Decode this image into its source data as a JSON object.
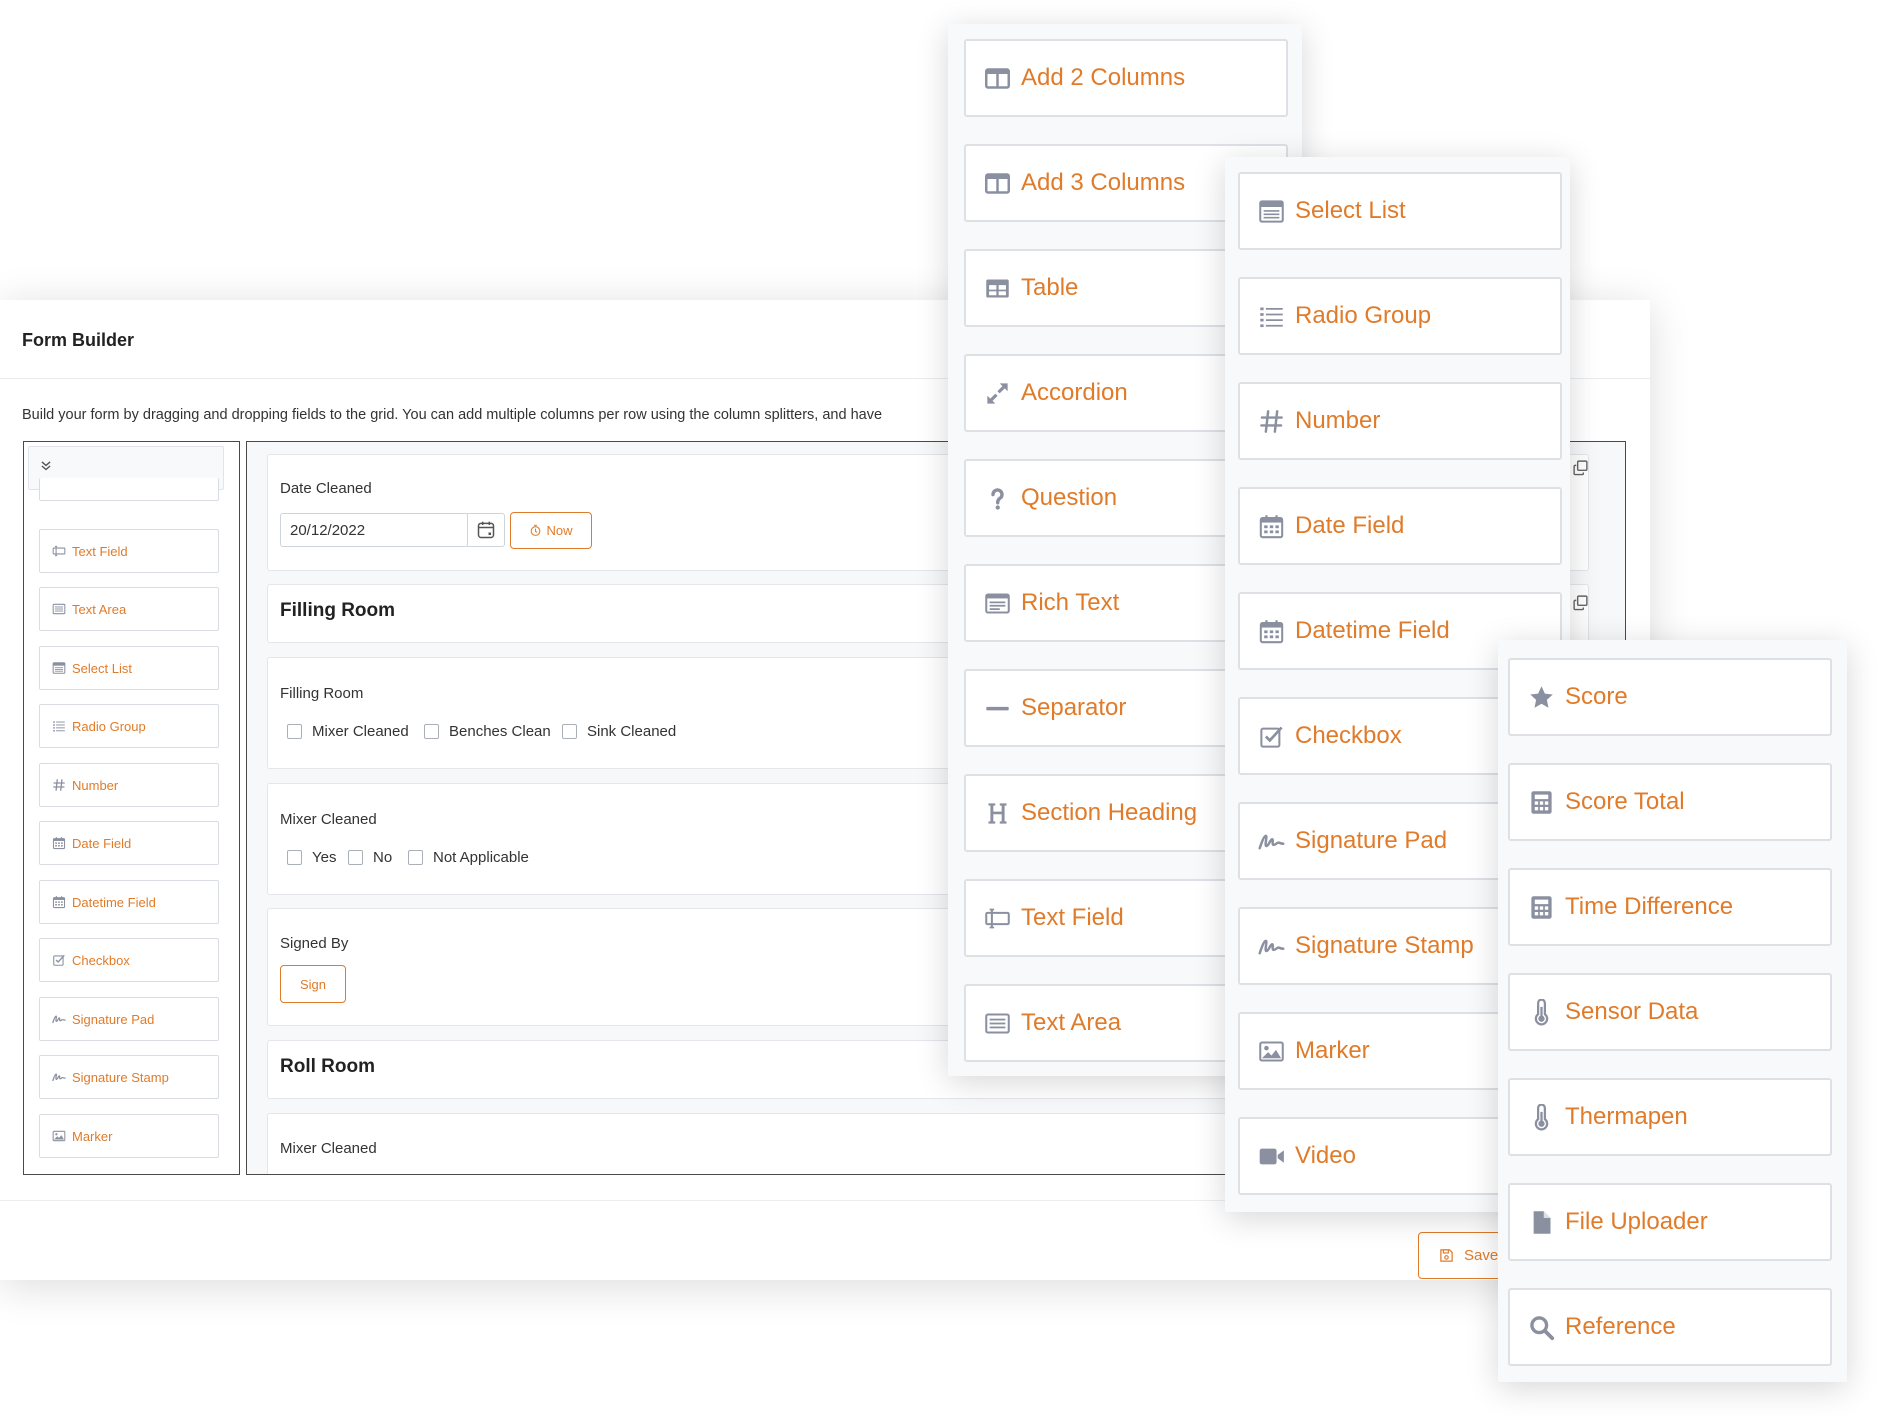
{
  "form_builder": {
    "title": "Form Builder",
    "description": "Build your form by dragging and dropping fields to the grid. You can add multiple columns per row using the column splitters, and have",
    "sidebar": {
      "items": [
        "Text Field",
        "Text Area",
        "Select List",
        "Radio Group",
        "Number",
        "Date Field",
        "Datetime Field",
        "Checkbox",
        "Signature Pad",
        "Signature Stamp",
        "Marker"
      ]
    },
    "grid": {
      "date_cleaned": {
        "label": "Date Cleaned",
        "value": "20/12/2022",
        "now_label": "Now"
      },
      "section_filling_room": "Filling Room",
      "filling_room_field": {
        "label": "Filling Room",
        "options": [
          "Mixer Cleaned",
          "Benches Clean",
          "Sink Cleaned"
        ]
      },
      "mixer_cleaned_field": {
        "label": "Mixer Cleaned",
        "options": [
          "Yes",
          "No",
          "Not Applicable"
        ]
      },
      "signed_by": {
        "label": "Signed By",
        "sign_label": "Sign"
      },
      "section_roll_room": "Roll Room",
      "mixer_cleaned_2": {
        "label": "Mixer Cleaned"
      }
    },
    "save_label": "Save"
  },
  "palette_1": [
    "Add 2 Columns",
    "Add 3 Columns",
    "Table",
    "Accordion",
    "Question",
    "Rich Text",
    "Separator",
    "Section Heading",
    "Text Field",
    "Text Area"
  ],
  "palette_2": [
    "Select List",
    "Radio Group",
    "Number",
    "Date Field",
    "Datetime Field",
    "Checkbox",
    "Signature Pad",
    "Signature Stamp",
    "Marker",
    "Video"
  ],
  "palette_3": [
    "Score",
    "Score Total",
    "Time Difference",
    "Sensor Data",
    "Thermapen",
    "File Uploader",
    "Reference"
  ],
  "icons": {
    "columns": "columns-icon",
    "table": "table-icon",
    "accordion": "expand-arrows-icon",
    "question": "question-icon",
    "rich_text": "rich-text-icon",
    "separator": "minus-icon",
    "heading": "heading-icon",
    "text_field": "text-field-icon",
    "text_area": "text-area-icon",
    "select": "select-list-icon",
    "radio": "list-icon",
    "number": "hash-icon",
    "date": "calendar-icon",
    "checkbox": "checkbox-icon",
    "signature": "signature-icon",
    "marker": "image-icon",
    "video": "video-icon",
    "score": "star-icon",
    "calculator": "calculator-icon",
    "thermometer": "thermometer-icon",
    "file": "file-icon",
    "search": "search-icon",
    "clock": "clock-icon",
    "save": "save-icon",
    "chevron": "chevron-down-icon",
    "copy": "copy-icon"
  },
  "colors": {
    "accent": "#e07b2a",
    "icon": "#8a90a0",
    "border": "#d9dde3"
  }
}
